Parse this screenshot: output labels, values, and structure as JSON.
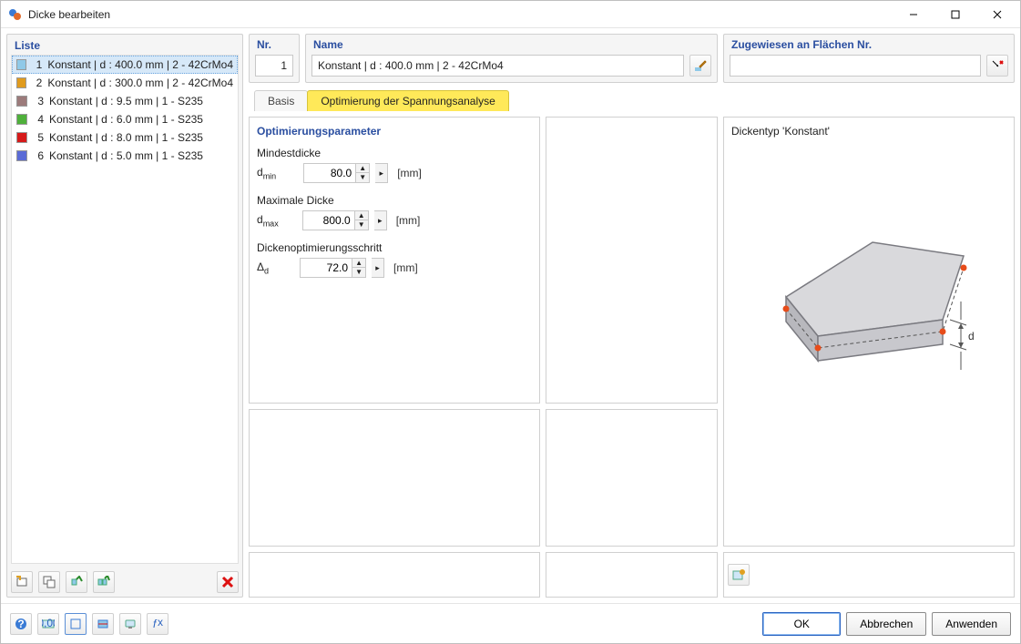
{
  "window": {
    "title": "Dicke bearbeiten"
  },
  "list": {
    "title": "Liste",
    "items": [
      {
        "num": "1",
        "color": "#8fc9e8",
        "label": "Konstant | d : 400.0 mm | 2 - 42CrMo4",
        "selected": true
      },
      {
        "num": "2",
        "color": "#e09b1e",
        "label": "Konstant | d : 300.0 mm | 2 - 42CrMo4"
      },
      {
        "num": "3",
        "color": "#9c7b7b",
        "label": "Konstant | d : 9.5 mm | 1 - S235"
      },
      {
        "num": "4",
        "color": "#4fb03b",
        "label": "Konstant | d : 6.0 mm | 1 - S235"
      },
      {
        "num": "5",
        "color": "#d61a1a",
        "label": "Konstant | d : 8.0 mm | 1 - S235"
      },
      {
        "num": "6",
        "color": "#5a6bd6",
        "label": "Konstant | d : 5.0 mm | 1 - S235"
      }
    ]
  },
  "header": {
    "nr_label": "Nr.",
    "nr_value": "1",
    "name_label": "Name",
    "name_value": "Konstant | d : 400.0 mm | 2 - 42CrMo4",
    "assigned_label": "Zugewiesen an Flächen Nr."
  },
  "tabs": {
    "basis": "Basis",
    "opt": "Optimierung der Spannungsanalyse"
  },
  "params": {
    "title": "Optimierungsparameter",
    "min_label": "Mindestdicke",
    "min_sym_pre": "d",
    "min_sym_sub": "min",
    "min_value": "80.0",
    "max_label": "Maximale Dicke",
    "max_sym_pre": "d",
    "max_sym_sub": "max",
    "max_value": "800.0",
    "step_label": "Dickenoptimierungsschritt",
    "step_sym_pre": "Δ",
    "step_sym_sub": "d",
    "step_value": "72.0",
    "unit": "[mm]"
  },
  "preview": {
    "title": "Dickentyp  'Konstant'",
    "dim_label": "d"
  },
  "footer": {
    "ok": "OK",
    "cancel": "Abbrechen",
    "apply": "Anwenden"
  }
}
